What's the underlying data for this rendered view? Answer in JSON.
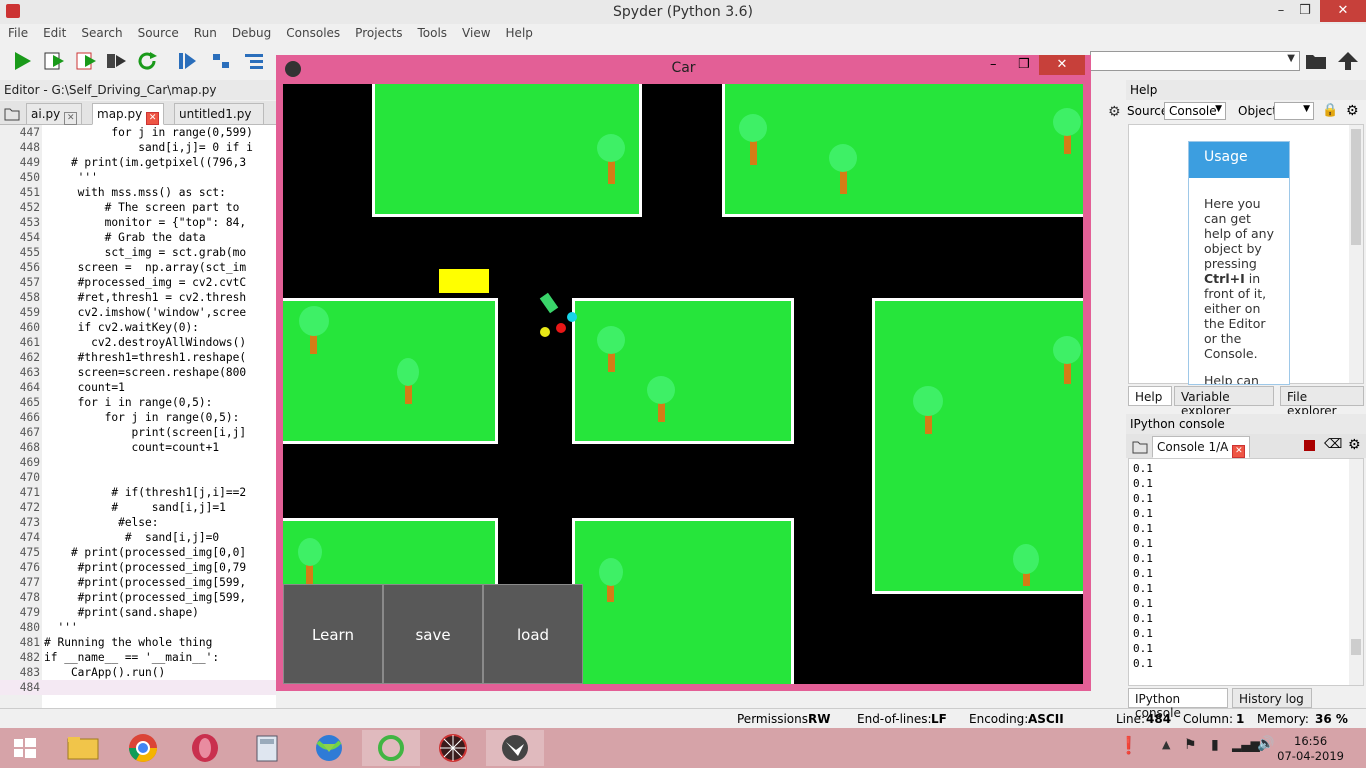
{
  "spyder": {
    "title": "Spyder (Python 3.6)",
    "menu": [
      "File",
      "Edit",
      "Search",
      "Source",
      "Run",
      "Debug",
      "Consoles",
      "Projects",
      "Tools",
      "View",
      "Help"
    ],
    "window_controls": {
      "minimize": "–",
      "maximize": "❒",
      "close": "✕"
    }
  },
  "editor": {
    "header": "Editor - G:\\Self_Driving_Car\\map.py",
    "tabs": [
      {
        "label": "ai.py",
        "active": false
      },
      {
        "label": "map.py",
        "active": true
      },
      {
        "label": "untitled1.py",
        "active": false
      }
    ],
    "lines": [
      {
        "n": "447",
        "t": "          for j in range(0,599)"
      },
      {
        "n": "448",
        "t": "              sand[i,j]= 0 if i"
      },
      {
        "n": "449",
        "t": "    # print(im.getpixel((796,3"
      },
      {
        "n": "450",
        "t": "     '''"
      },
      {
        "n": "451",
        "t": "     with mss.mss() as sct:"
      },
      {
        "n": "452",
        "t": "         # The screen part to"
      },
      {
        "n": "453",
        "t": "         monitor = {\"top\": 84,"
      },
      {
        "n": "454",
        "t": "         # Grab the data"
      },
      {
        "n": "455",
        "t": "         sct_img = sct.grab(mo"
      },
      {
        "n": "456",
        "t": "     screen =  np.array(sct_im"
      },
      {
        "n": "457",
        "t": "     #processed_img = cv2.cvtC"
      },
      {
        "n": "458",
        "t": "     #ret,thresh1 = cv2.thresh"
      },
      {
        "n": "459",
        "t": "     cv2.imshow('window',scree"
      },
      {
        "n": "460",
        "t": "     if cv2.waitKey(0):"
      },
      {
        "n": "461",
        "t": "       cv2.destroyAllWindows()"
      },
      {
        "n": "462",
        "t": "     #thresh1=thresh1.reshape("
      },
      {
        "n": "463",
        "t": "     screen=screen.reshape(800"
      },
      {
        "n": "464",
        "t": "     count=1"
      },
      {
        "n": "465",
        "t": "     for i in range(0,5):"
      },
      {
        "n": "466",
        "t": "         for j in range(0,5):"
      },
      {
        "n": "467",
        "t": "             print(screen[i,j]"
      },
      {
        "n": "468",
        "t": "             count=count+1"
      },
      {
        "n": "469",
        "t": ""
      },
      {
        "n": "470",
        "t": ""
      },
      {
        "n": "471",
        "t": "          # if(thresh1[j,i]==2"
      },
      {
        "n": "472",
        "t": "          #     sand[i,j]=1"
      },
      {
        "n": "473",
        "t": "           #else:"
      },
      {
        "n": "474",
        "t": "            #  sand[i,j]=0"
      },
      {
        "n": "475",
        "t": "    # print(processed_img[0,0]"
      },
      {
        "n": "476",
        "t": "     #print(processed_img[0,79"
      },
      {
        "n": "477",
        "t": "     #print(processed_img[599,"
      },
      {
        "n": "478",
        "t": "     #print(processed_img[599,"
      },
      {
        "n": "479",
        "t": "     #print(sand.shape)"
      },
      {
        "n": "480",
        "t": "  '''"
      },
      {
        "n": "481",
        "t": "# Running the whole thing"
      },
      {
        "n": "482",
        "t": "if __name__ == '__main__':"
      },
      {
        "n": "483",
        "t": "    CarApp().run()"
      },
      {
        "n": "484",
        "t": ""
      }
    ]
  },
  "status": {
    "permissions_label": "Permissions:",
    "permissions": "RW",
    "eol_label": "End-of-lines:",
    "eol": "LF",
    "encoding_label": "Encoding:",
    "encoding": "ASCII",
    "line_label": "Line:",
    "line": "484",
    "column_label": "Column:",
    "column": "1",
    "memory_label": "Memory:",
    "memory": "36 %"
  },
  "help": {
    "header": "Help",
    "source_label": "Source",
    "source_value": "Console",
    "object_label": "Object",
    "usage_title": "Usage",
    "usage_text_1": "Here you can get help of any object by pressing",
    "usage_bold": "Ctrl+I",
    "usage_text_2": "in front of it, either on the Editor or the Console.",
    "usage_text_3": "Help can",
    "tabs": [
      "Help",
      "Variable explorer",
      "File explorer"
    ]
  },
  "ipython": {
    "header": "IPython console",
    "tab": "Console 1/A",
    "output": [
      "0.1",
      "0.1",
      "0.1",
      "0.1",
      "0.1",
      "0.1",
      "0.1",
      "0.1",
      "0.1",
      "0.1",
      "0.1",
      "0.1",
      "0.1",
      "0.1"
    ],
    "bottom_tabs": [
      "IPython console",
      "History log"
    ]
  },
  "car_app": {
    "title": "Car",
    "buttons": {
      "learn": "Learn",
      "save": "save",
      "load": "load"
    },
    "colors": {
      "road": "#000000",
      "grass": "#26e53b",
      "border": "#ffffff",
      "trunk": "#d47d16",
      "crown": "#3ef066",
      "car": "#3ad46a",
      "goal": "#ffff00"
    }
  },
  "taskbar": {
    "time": "16:56",
    "date": "07-04-2019",
    "apps": [
      "start-button",
      "file-explorer-icon",
      "chrome-icon",
      "opera-icon",
      "calculator-icon",
      "internet-download-manager-icon",
      "green-ring-app-icon",
      "spider-web-app-icon",
      "kivy-app-icon"
    ]
  }
}
